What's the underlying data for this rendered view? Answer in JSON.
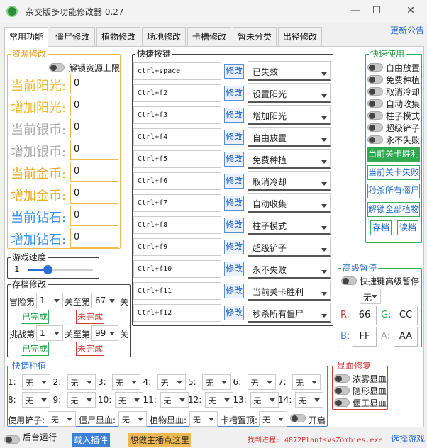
{
  "window": {
    "title": "杂交版多功能修改器  0.27",
    "update_link": "更新公告"
  },
  "tabs": [
    "常用功能",
    "僵尸修改",
    "植物修改",
    "场地修改",
    "卡槽修改",
    "暂未分类",
    "出径修改"
  ],
  "resources": {
    "title": "资源修改",
    "unlock_label": "解锁资源上限",
    "items": [
      {
        "label": "当前阳光:",
        "value": "0",
        "color": "#f0b830"
      },
      {
        "label": "增加阳光:",
        "value": "0",
        "color": "#f0b830"
      },
      {
        "label": "当前银币:",
        "value": "0",
        "color": "#a8a8a8"
      },
      {
        "label": "增加银币:",
        "value": "0",
        "color": "#a8a8a8"
      },
      {
        "label": "当前金币:",
        "value": "0",
        "color": "#e8a820"
      },
      {
        "label": "增加金币:",
        "value": "0",
        "color": "#e8a820"
      },
      {
        "label": "当前钻石:",
        "value": "0",
        "color": "#3a8fe8"
      },
      {
        "label": "增加钻石:",
        "value": "0",
        "color": "#3a8fe8"
      }
    ]
  },
  "speed": {
    "title": "游戏速度",
    "value": "1",
    "level": 0.3
  },
  "save": {
    "title": "存档修改",
    "adventure_label": "冒险第",
    "adventure_num": "1",
    "level_label": "关至第",
    "adventure_level": "67",
    "level_suffix": "关",
    "challenge_label": "挑战第",
    "challenge_num": "1",
    "challenge_level": "99",
    "done": "已完成",
    "not_done": "未完成"
  },
  "hotkeys": {
    "title": "快捷按键",
    "modify_label": "修改",
    "rows": [
      {
        "key": "ctrl+space",
        "action": "已失效"
      },
      {
        "key": "Ctrl+f2",
        "action": "设置阳光"
      },
      {
        "key": "Ctrl+f3",
        "action": "增加阳光"
      },
      {
        "key": "Ctrl+f4",
        "action": "自由放置"
      },
      {
        "key": "Ctrl+f5",
        "action": "免费种植"
      },
      {
        "key": "Ctrl+f6",
        "action": "取消冷却"
      },
      {
        "key": "Ctrl+f7",
        "action": "自动收集"
      },
      {
        "key": "Ctrl+f8",
        "action": "柱子模式"
      },
      {
        "key": "Ctrl+f9",
        "action": "超级铲子"
      },
      {
        "key": "Ctrl+f10",
        "action": "永不失败"
      },
      {
        "key": "Ctrl+f11",
        "action": "当前关卡胜利"
      },
      {
        "key": "Ctrl+f12",
        "action": "秒杀所有僵尸"
      }
    ]
  },
  "quick": {
    "title": "快速使用",
    "toggles": [
      "自由放置",
      "免费种植",
      "取消冷却",
      "自动收集",
      "柱子模式",
      "超级铲子",
      "永不失败"
    ],
    "win": "当前关卡胜利",
    "lose": "当前关卡失败",
    "kill": "秒杀所有僵尸",
    "unlock": "解锁全部植物",
    "save": "存档",
    "load": "读档"
  },
  "pause": {
    "title": "高级暂停",
    "toggle_label": "快捷键高级暂停",
    "select": "无",
    "r": "66",
    "g": "CC",
    "b": "FF",
    "a": "AA"
  },
  "blood": {
    "title": "显血修复",
    "items": [
      "浓雾显血",
      "隐形显血",
      "僵王显血"
    ]
  },
  "plant": {
    "title": "快捷种植",
    "slots": [
      {
        "n": "1:",
        "v": "无"
      },
      {
        "n": "2:",
        "v": "无"
      },
      {
        "n": "3:",
        "v": "无"
      },
      {
        "n": "4:",
        "v": "无"
      },
      {
        "n": "5:",
        "v": "无"
      },
      {
        "n": "6:",
        "v": "无"
      },
      {
        "n": "7:",
        "v": "无"
      },
      {
        "n": "8:",
        "v": "无"
      },
      {
        "n": "9:",
        "v": "无"
      },
      {
        "n": "10:",
        "v": "无"
      },
      {
        "n": "11:",
        "v": "无"
      },
      {
        "n": "12:",
        "v": "无"
      },
      {
        "n": "13:",
        "v": "无"
      },
      {
        "n": "14:",
        "v": "无"
      }
    ],
    "shovel_label": "使用铲子:",
    "shovel": "无",
    "zombie_blood_label": "僵尸显血:",
    "zombie_blood": "无",
    "plant_blood_label": "植物显血:",
    "plant_blood": "无",
    "slot_top_label": "卡槽置顶:",
    "slot_top": "无",
    "open_label": "开启"
  },
  "footer": {
    "background": "后台运行",
    "plugin": "载入插件",
    "host": "想做主播点这里",
    "process": "找到进程: 4872PlantsVsZombies.exe",
    "select_game": "选择游戏"
  }
}
